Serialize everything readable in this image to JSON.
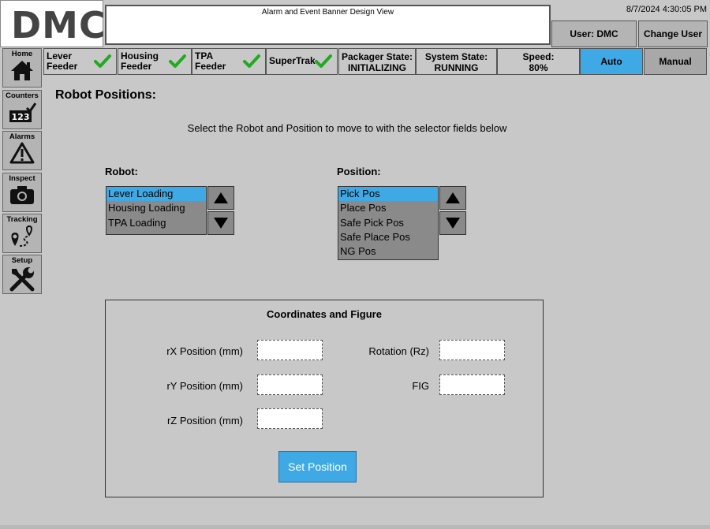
{
  "header": {
    "logo_text": "DMC",
    "banner_text": "Alarm and Event Banner Design View",
    "datetime": "8/7/2024 4:30:05 PM",
    "user_label": "User: DMC",
    "change_user_label": "Change User"
  },
  "status": {
    "feeders": [
      {
        "line1": "Lever",
        "line2": "Feeder"
      },
      {
        "line1": "Housing",
        "line2": "Feeder"
      },
      {
        "line1": "TPA",
        "line2": "Feeder"
      },
      {
        "line1": "SuperTrak",
        "line2": ""
      }
    ],
    "packager": {
      "label": "Packager State:",
      "value": "INITIALIZING"
    },
    "system": {
      "label": "System State:",
      "value": "RUNNING"
    },
    "speed": {
      "label": "Speed:",
      "value": "80%"
    },
    "auto_label": "Auto",
    "manual_label": "Manual",
    "check_color": "#22aa22"
  },
  "nav": [
    {
      "label": "Home",
      "icon": "home-icon"
    },
    {
      "label": "Counters",
      "icon": "counter-icon"
    },
    {
      "label": "Alarms",
      "icon": "warning-icon"
    },
    {
      "label": "Inspect",
      "icon": "camera-icon"
    },
    {
      "label": "Tracking",
      "icon": "tracking-icon"
    },
    {
      "label": "Setup",
      "icon": "tools-icon"
    }
  ],
  "counter_digits": "123",
  "page": {
    "title": "Robot Positions:",
    "instructions": "Select the Robot and Position to move to with the selector fields below"
  },
  "robot": {
    "label": "Robot:",
    "items": [
      "Lever Loading",
      "Housing Loading",
      "TPA Loading"
    ],
    "selected_index": 0
  },
  "position": {
    "label": "Position:",
    "items": [
      "Pick Pos",
      "Place Pos",
      "Safe Pick Pos",
      "Safe Place Pos",
      "NG Pos"
    ],
    "selected_index": 0
  },
  "coords": {
    "title": "Coordinates and Figure",
    "rx_label": "rX Position (mm)",
    "ry_label": "rY Position (mm)",
    "rz_label": "rZ Position (mm)",
    "rot_label": "Rotation (Rz)",
    "fig_label": "FIG",
    "rx_value": "",
    "ry_value": "",
    "rz_value": "",
    "rot_value": "",
    "fig_value": "",
    "set_label": "Set Position"
  },
  "colors": {
    "accent": "#3fa9e6",
    "background": "#c8c8c8",
    "list_bg": "#8a8a8a"
  }
}
